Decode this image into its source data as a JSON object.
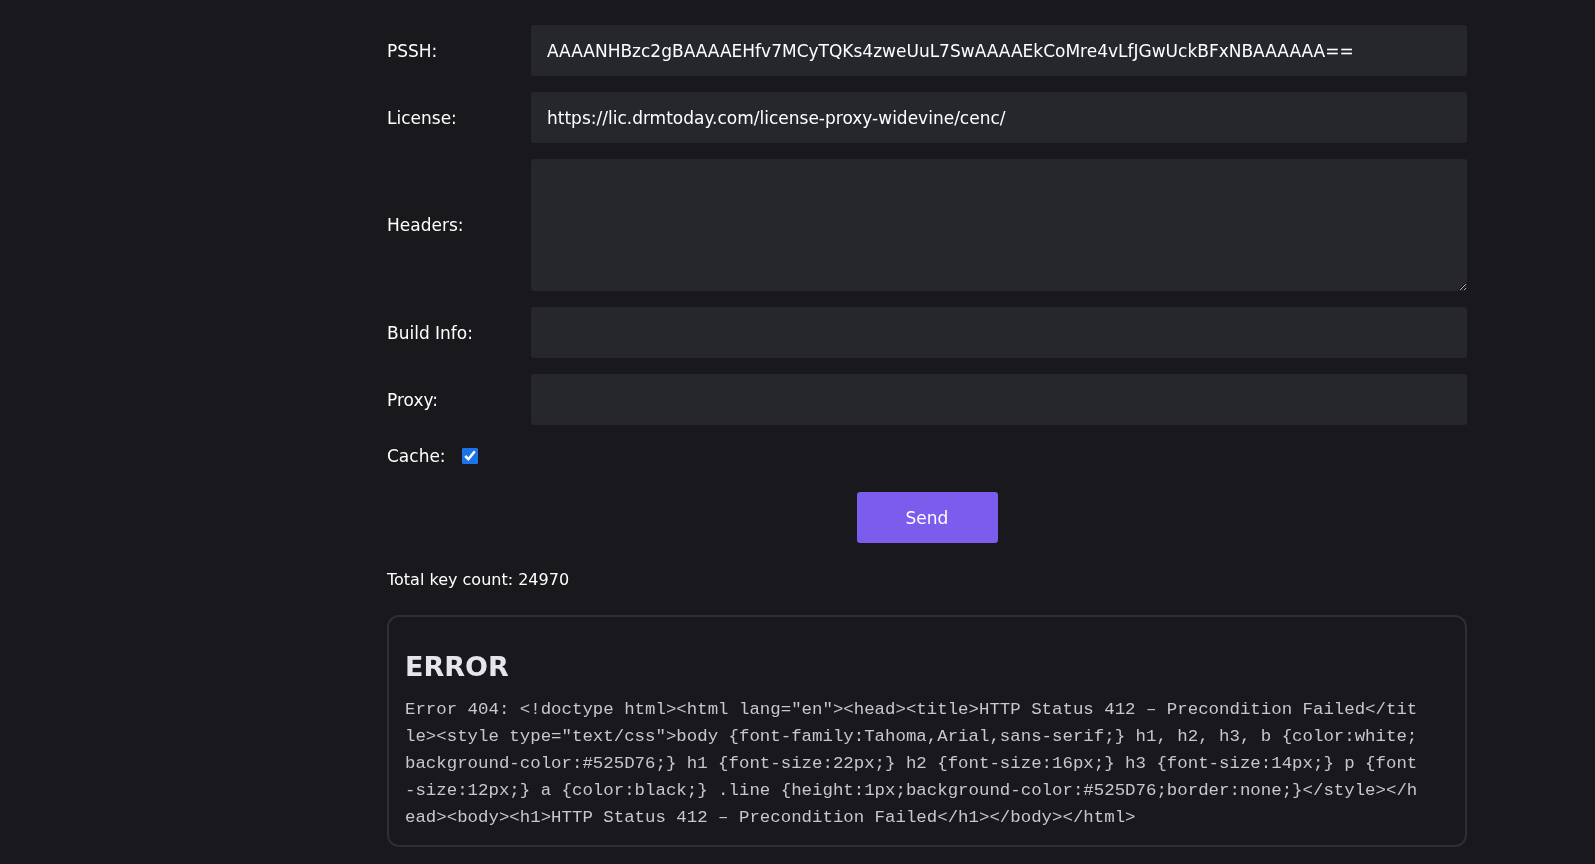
{
  "fields": [
    {
      "label": "PSSH:",
      "kind": "input",
      "value": "AAAANHBzc2gBAAAAEHfv7MCyTQKs4zweUuL7SwAAAAEkCoMre4vLfJGwUckBFxNBAAAAAA=="
    },
    {
      "label": "License:",
      "kind": "input",
      "value": "https://lic.drmtoday.com/license-proxy-widevine/cenc/"
    },
    {
      "label": "Headers:",
      "kind": "textarea"
    },
    {
      "label": "Build Info:",
      "kind": "input"
    },
    {
      "label": "Proxy:",
      "kind": "input"
    }
  ],
  "cache": {
    "label": "Cache:",
    "checked": true
  },
  "send_button": "Send",
  "key_count": "Total key count: 24970",
  "error": {
    "title": "ERROR",
    "message": "Error 404: <!doctype html><html lang=\"en\"><head><title>HTTP Status 412 – Precondition Failed</title><style type=\"text/css\">body {font-family:Tahoma,Arial,sans-serif;} h1, h2, h3, b {color:white;background-color:#525D76;} h1 {font-size:22px;} h2 {font-size:16px;} h3 {font-size:14px;} p {font-size:12px;} a {color:black;} .line {height:1px;background-color:#525D76;border:none;}</style></head><body><h1>HTTP Status 412 – Precondition Failed</h1></body></html>"
  }
}
